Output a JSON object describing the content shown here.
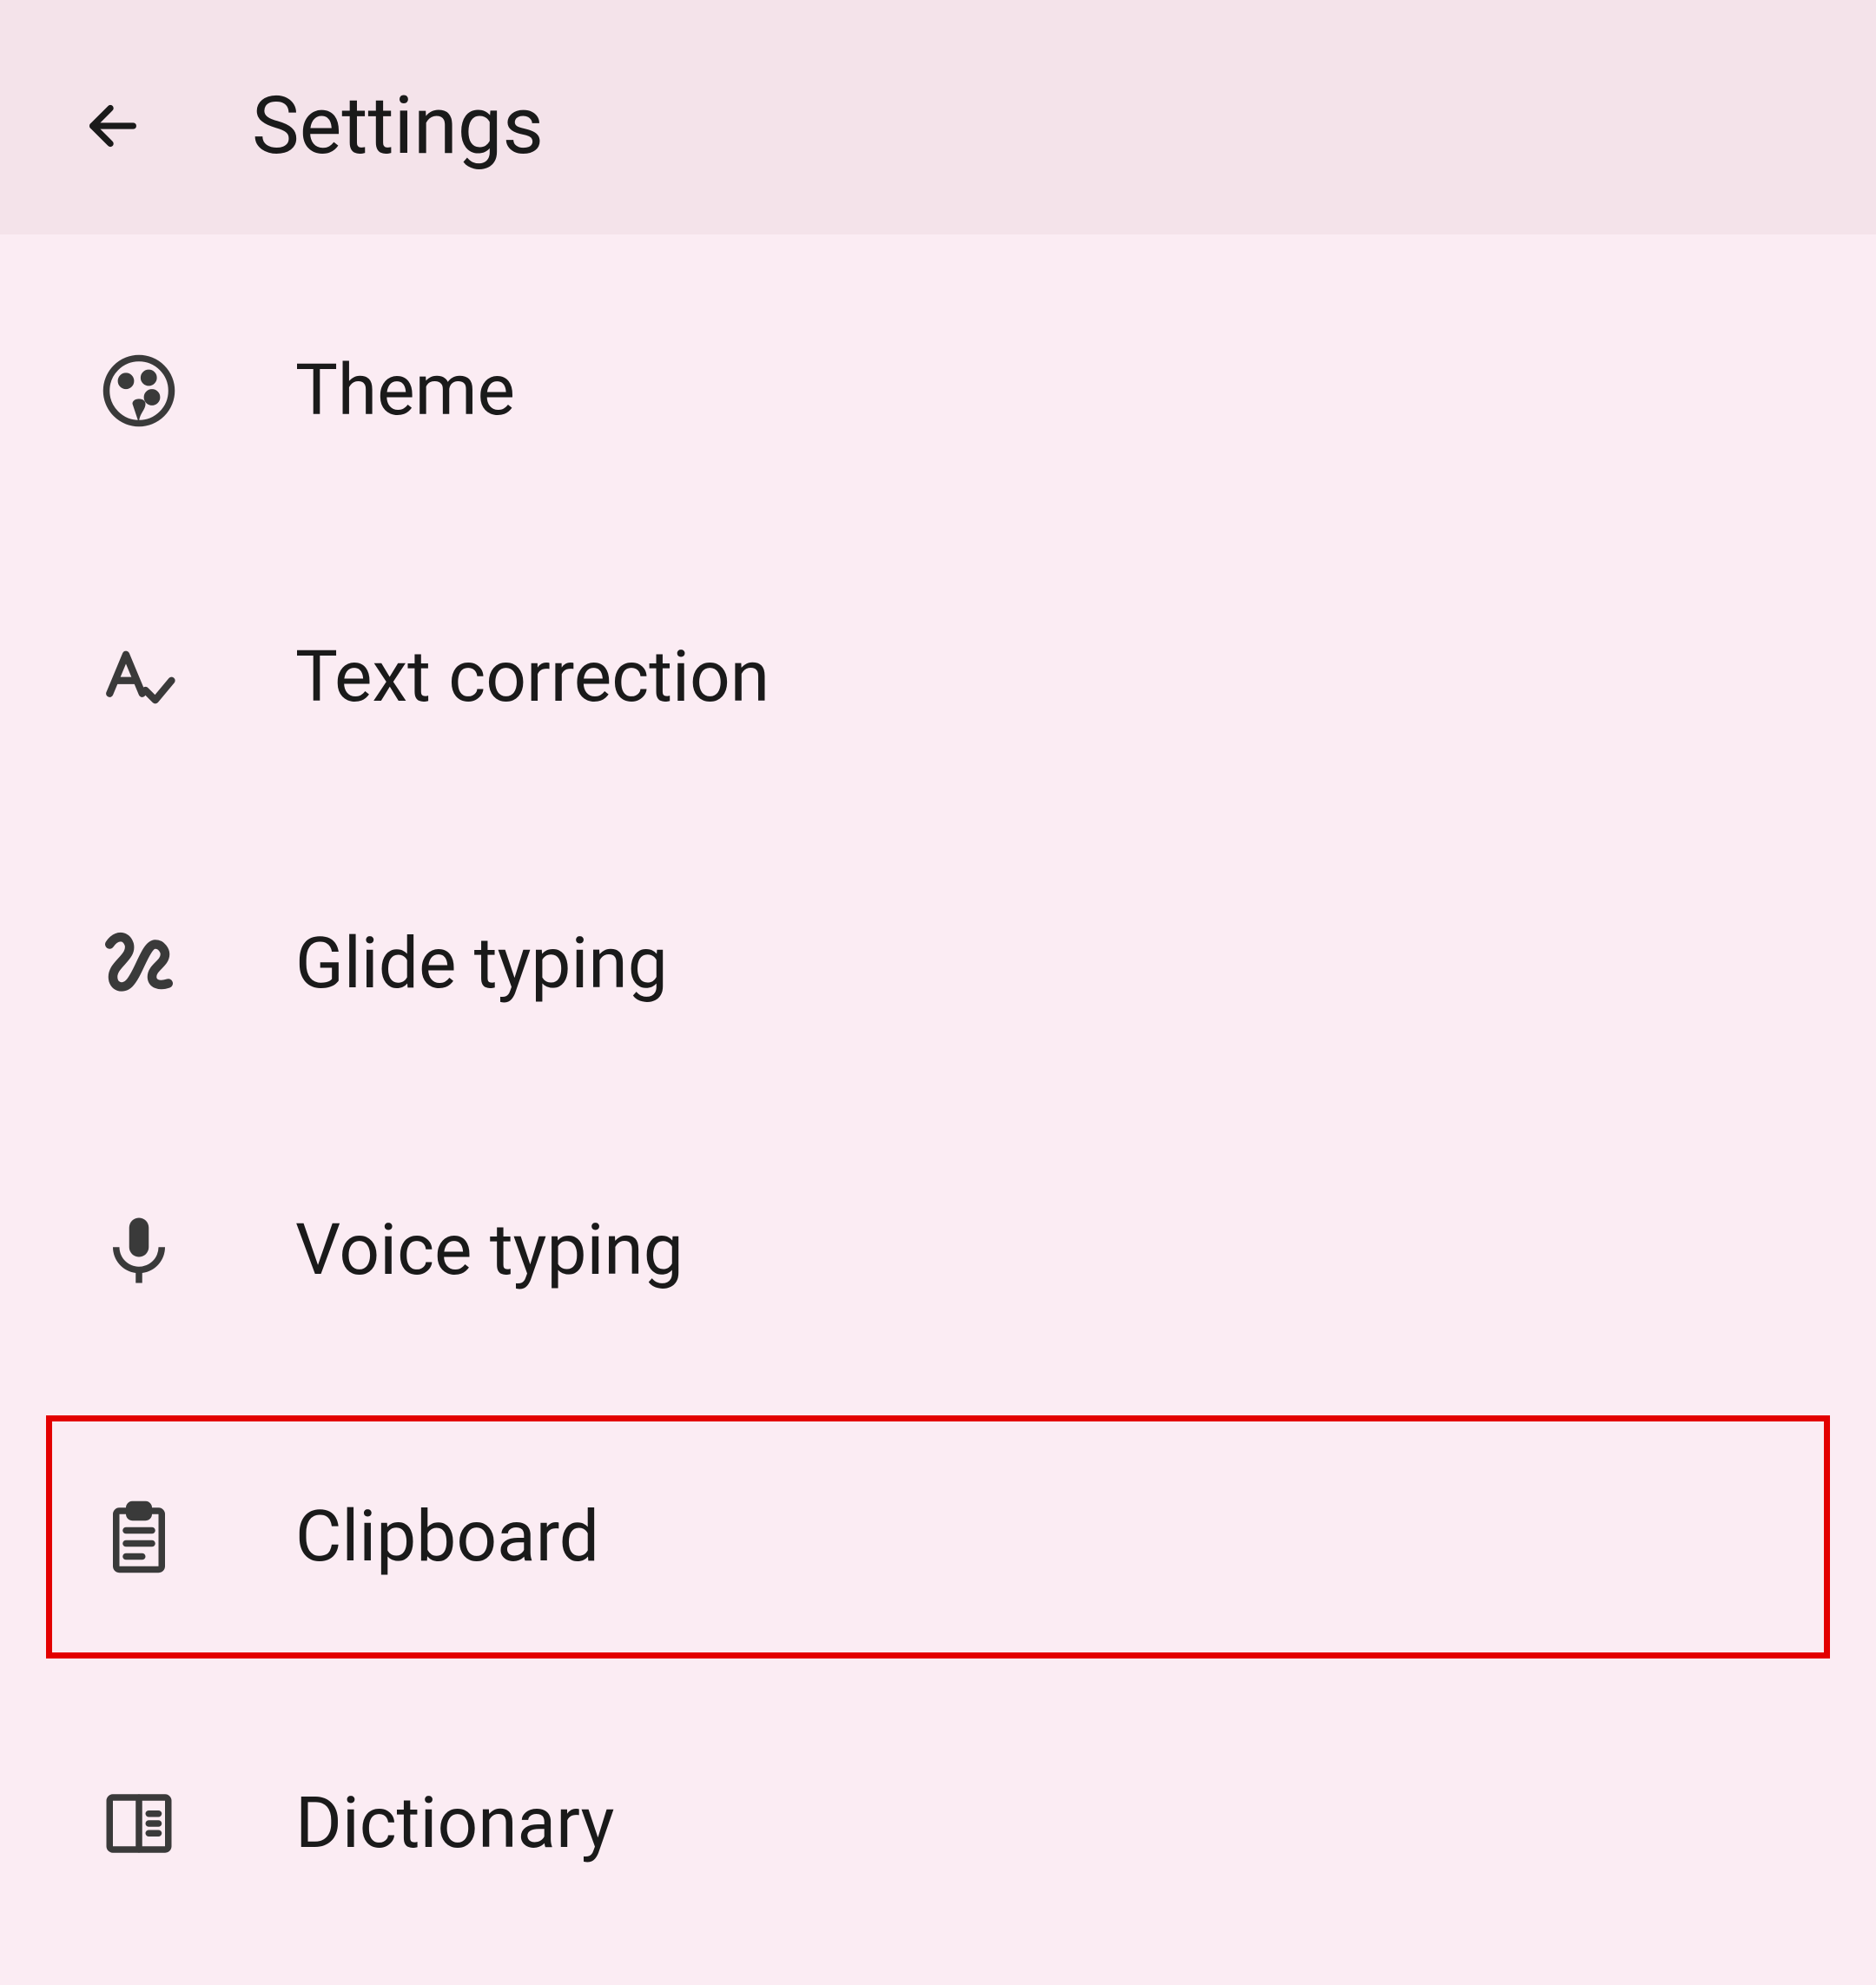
{
  "header": {
    "title": "Settings"
  },
  "items": [
    {
      "label": "Theme",
      "icon": "palette-icon",
      "highlighted": false
    },
    {
      "label": "Text correction",
      "icon": "text-correction-icon",
      "highlighted": false
    },
    {
      "label": "Glide typing",
      "icon": "gesture-icon",
      "highlighted": false
    },
    {
      "label": "Voice typing",
      "icon": "mic-icon",
      "highlighted": false
    },
    {
      "label": "Clipboard",
      "icon": "clipboard-icon",
      "highlighted": true
    },
    {
      "label": "Dictionary",
      "icon": "dictionary-icon",
      "highlighted": false
    }
  ]
}
